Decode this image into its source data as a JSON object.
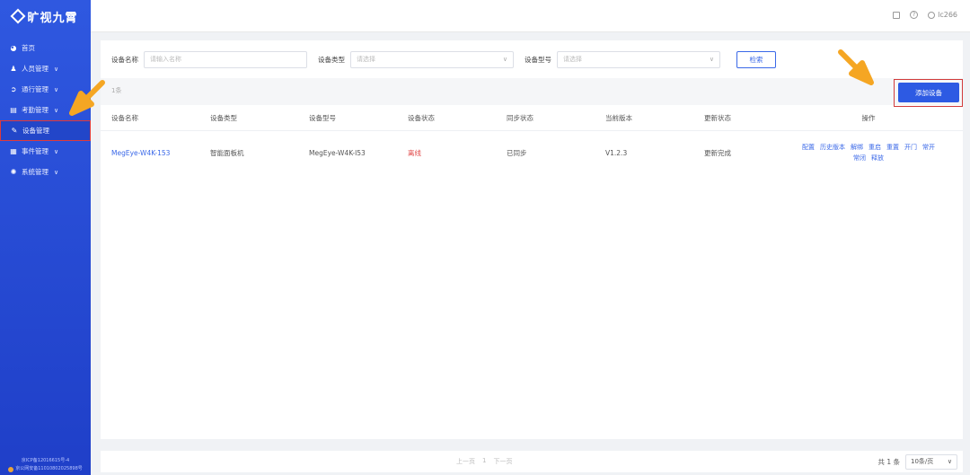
{
  "brand": {
    "name": "旷视九霄"
  },
  "sidebar": {
    "items": [
      {
        "label": "首页",
        "icon": "pie-chart-icon",
        "has_children": false
      },
      {
        "label": "人员管理",
        "icon": "people-icon",
        "has_children": true
      },
      {
        "label": "通行管理",
        "icon": "circle-arrow-icon",
        "has_children": true
      },
      {
        "label": "考勤管理",
        "icon": "calendar-icon",
        "has_children": true
      },
      {
        "label": "设备管理",
        "icon": "tool-icon",
        "has_children": false,
        "active": true
      },
      {
        "label": "事件管理",
        "icon": "document-icon",
        "has_children": true
      },
      {
        "label": "系统管理",
        "icon": "gear-icon",
        "has_children": true
      }
    ],
    "footer_line1": "京ICP备12016615号-4",
    "footer_line2": "京公网安备11010802025898号"
  },
  "topbar": {
    "user_name": "lc266"
  },
  "filters": {
    "device_name_label": "设备名称",
    "device_name_placeholder": "请输入名称",
    "device_type_label": "设备类型",
    "device_type_placeholder": "请选择",
    "device_model_label": "设备型号",
    "device_model_placeholder": "请选择",
    "search_label": "检索"
  },
  "toolbar": {
    "hint": "1条",
    "add_device_label": "添加设备"
  },
  "table": {
    "columns": [
      "设备名称",
      "设备类型",
      "设备型号",
      "设备状态",
      "同步状态",
      "当前版本",
      "更新状态",
      "操作"
    ],
    "rows": [
      {
        "name": "MegEye-W4K-153",
        "type": "智能面板机",
        "model": "MegEye-W4K-I53",
        "status": "离线",
        "sync": "已同步",
        "version": "V1.2.3",
        "update": "更新完成",
        "actions": [
          "配置",
          "历史版本",
          "解绑",
          "重启",
          "重置",
          "开门",
          "常开",
          "常闭",
          "释放"
        ]
      }
    ]
  },
  "pager": {
    "prev": "上一页",
    "page": "1",
    "next": "下一页",
    "total": "共 1 条",
    "page_size": "10条/页"
  },
  "colors": {
    "accent": "#2d5ae3",
    "sidebar": "#2448d6",
    "danger": "#e04848",
    "highlight_border": "#d23b3b",
    "arrow": "#f5a623"
  }
}
